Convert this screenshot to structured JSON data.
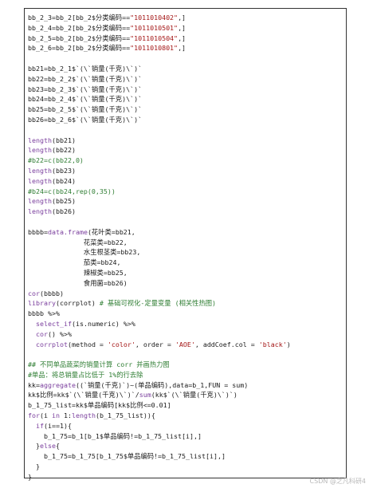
{
  "code_lines": [
    "bb_2_3=bb_2[bb_2$分类编码==\"1011010402\",]",
    "bb_2_4=bb_2[bb_2$分类编码==\"1011010501\",]",
    "bb_2_5=bb_2[bb_2$分类编码==\"1011010504\",]",
    "bb_2_6=bb_2[bb_2$分类编码==\"1011010801\",]",
    "",
    "bb21=bb_2_1$`(\\`销量(千克)\\`)`",
    "bb22=bb_2_2$`(\\`销量(千克)\\`)`",
    "bb23=bb_2_3$`(\\`销量(千克)\\`)`",
    "bb24=bb_2_4$`(\\`销量(千克)\\`)`",
    "bb25=bb_2_5$`(\\`销量(千克)\\`)`",
    "bb26=bb_2_6$`(\\`销量(千克)\\`)`",
    "",
    "length(bb21)",
    "length(bb22)",
    "#b22=c(bb22,0)",
    "length(bb23)",
    "length(bb24)",
    "#b24=c(bb24,rep(0,35))",
    "length(bb25)",
    "length(bb26)",
    "",
    "bbbb=data.frame(花叶类=bb21,",
    "              花菜类=bb22,",
    "              水生根茎类=bb23,",
    "              茄类=bb24,",
    "              辣椒类=bb25,",
    "              食用菌=bb26)",
    "cor(bbbb)",
    "library(corrplot) # 基础可视化-定量变量 (相关性热图)",
    "bbbb %>%",
    "  select_if(is.numeric) %>%",
    "  cor() %>%",
    "  corrplot(method = 'color', order = 'AOE', addCoef.col = 'black')",
    "",
    "## 不同单品蔬菜的销量计算 corr 并画热力图",
    "#单品：将总销量占比低于 1%的行去除",
    "kk=aggregate((`销量(千克)`)~(单品编码),data=b_1,FUN = sum)",
    "kk$比例=kk$`(\\`销量(千克)\\`)`/sum(kk$`(\\`销量(千克)\\`)`)",
    "b_1_75_list=kk$单品编码[kk$比例<=0.01]",
    "for(i in 1:length(b_1_75_list)){",
    "  if(i==1){",
    "    b_1_75=b_1[b_1$单品编码!=b_1_75_list[i],]",
    "  }else{",
    "    b_1_75=b_1_75[b_1_75$单品编码!=b_1_75_list[i],]",
    "  }",
    "}"
  ],
  "watermark": "CSDN @之凡科研4",
  "colors": {
    "string": "#a31515",
    "comment": "#2e7d32",
    "function": "#7a3e9d",
    "text": "#1a1a1a",
    "border": "#333333"
  }
}
